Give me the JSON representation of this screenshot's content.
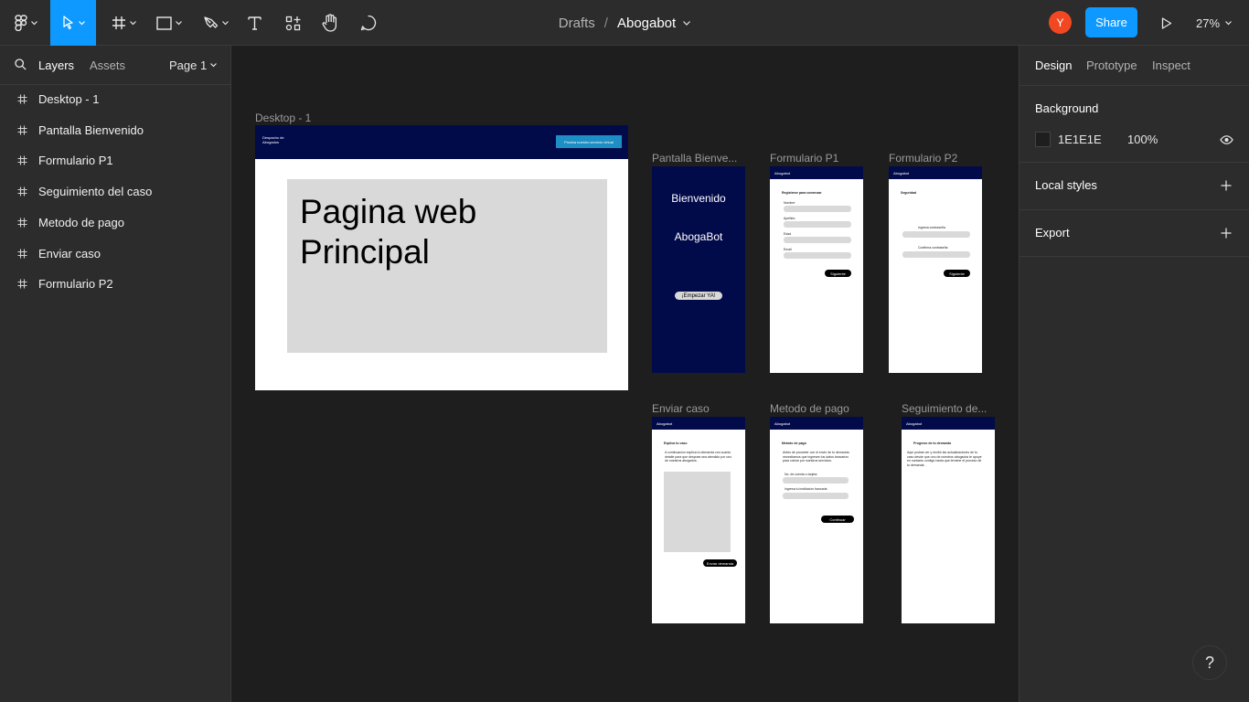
{
  "toolbar": {
    "tools": [
      "main-menu",
      "move-tool",
      "frame-tool",
      "shape-tool",
      "pen-tool",
      "text-tool",
      "resources-tool",
      "hand-tool",
      "comment-tool"
    ],
    "breadcrumb_drafts": "Drafts",
    "breadcrumb_sep": "/",
    "file_name": "Abogabot",
    "avatar_initial": "Y",
    "share_label": "Share",
    "zoom": "27%",
    "accent_color": "#0d99ff"
  },
  "left_panel": {
    "tab_layers": "Layers",
    "tab_assets": "Assets",
    "page_selector": "Page 1",
    "layers": [
      "Desktop - 1",
      "Pantalla Bienvenido",
      "Formulario P1",
      "Seguimiento del caso",
      "Metodo de pago",
      "Enviar caso",
      "Formulario P2"
    ]
  },
  "right_panel": {
    "tabs": [
      "Design",
      "Prototype",
      "Inspect"
    ],
    "background_title": "Background",
    "background_hex": "1E1E1E",
    "background_opacity": "100%",
    "local_styles": "Local styles",
    "export": "Export"
  },
  "canvas": {
    "labels": {
      "desktop": "Desktop - 1",
      "bienvenido": "Pantalla Bienve...",
      "form1": "Formulario P1",
      "form2": "Formulario P2",
      "enviar": "Enviar caso",
      "pago": "Metodo de pago",
      "seguimiento": "Seguimiento de..."
    },
    "desktop": {
      "brand": "Despacho de Abogados",
      "cta": "Prueba nuestro servicio virtual",
      "hero": "Pagina web Principal"
    },
    "bienvenido": {
      "title": "Bienvenido",
      "brand": "AbogaBot",
      "cta": "¡Empezar YA!"
    },
    "form1": {
      "brand": "Abogabot",
      "heading": "Registrese para comenzar",
      "fields": [
        "Nombre",
        "Apellido",
        "Edad",
        "Email"
      ],
      "button": "Siguiente"
    },
    "form2": {
      "brand": "Abogabot",
      "heading": "Seguridad",
      "fields": [
        "Ingresa contraseña",
        "Confirma contraseña"
      ],
      "button": "Siguiente"
    },
    "enviar": {
      "brand": "Abogabot",
      "heading": "Explica tu caso",
      "body": "A continuacion explica tu demanda con cuanto detalle para que despues sea atendido por uno de nuestros abogados.",
      "button": "Enviar demanda"
    },
    "pago": {
      "brand": "Abogabot",
      "heading": "Metodo de pago",
      "body": "Antes de proceder con el envio de tu demanda necesitamos que ingreses tus datos bancarios para cobrar por nuestros servicios.",
      "fields": [
        "No. de cuenta o tarjeta",
        "Ingresa tu institucion bancaria"
      ],
      "button": "Continuar"
    },
    "seguimiento": {
      "brand": "Abogabot",
      "heading": "Progreso de tu demanda",
      "body": "Aqui podras ver y recibir las actualizaciones de tu caso desde que uno de nuestros abogados te apoye en contacto contigo hasta que termine el proceso de tu demanda."
    }
  },
  "help_label": "?"
}
